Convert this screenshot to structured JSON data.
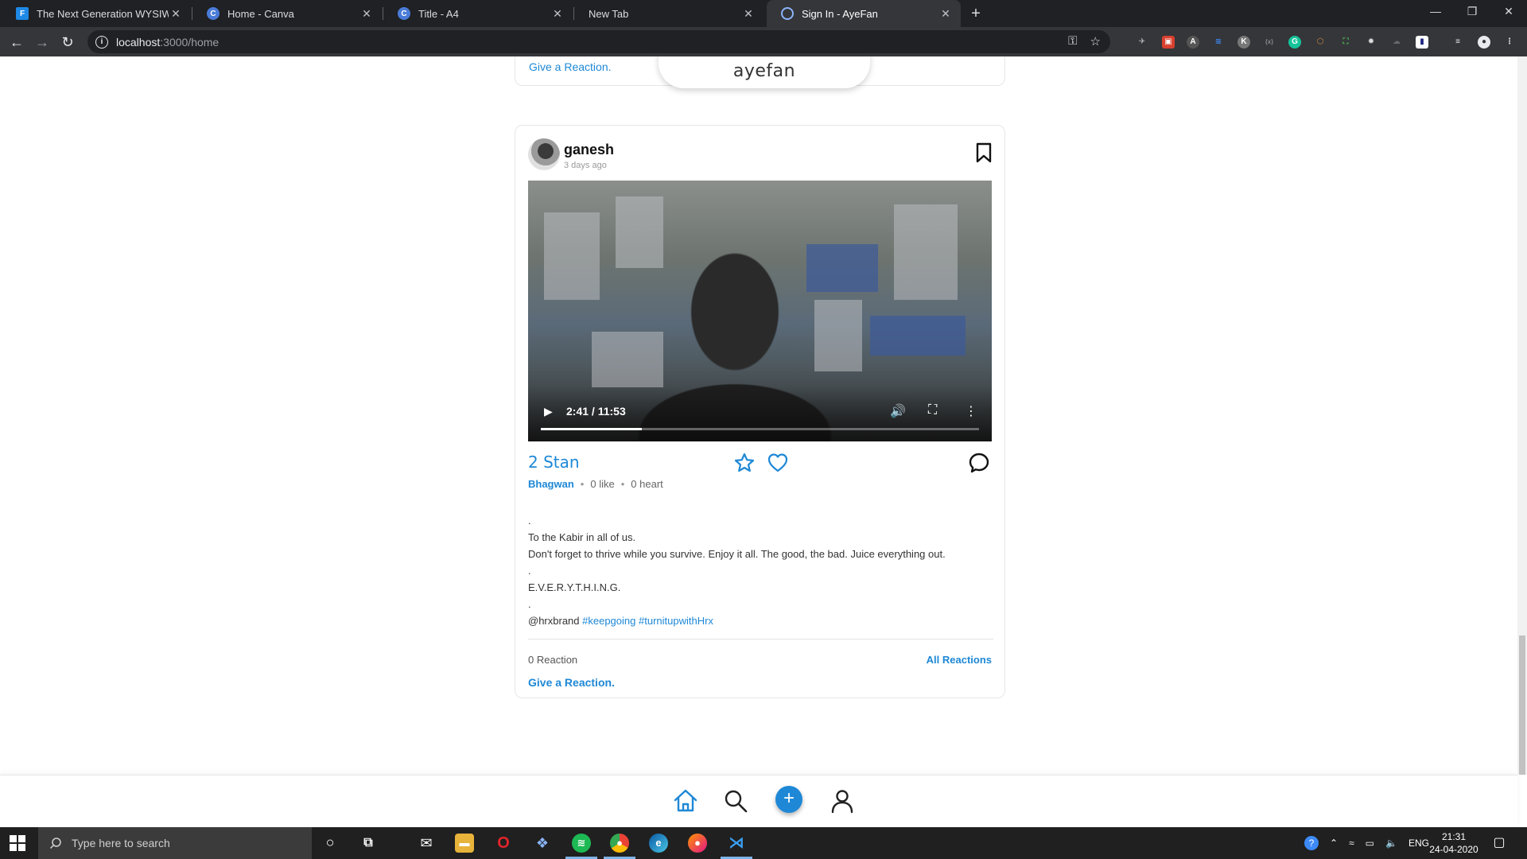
{
  "browser": {
    "tabs": [
      {
        "title": "The Next Generation WYSIWYG I",
        "favicon": "froala-icon",
        "fav_letter": "F",
        "fav_color": "#1e88e5"
      },
      {
        "title": "Home - Canva",
        "favicon": "canva-icon",
        "fav_letter": "C",
        "fav_color": "#4a7bd8"
      },
      {
        "title": "Title - A4",
        "favicon": "canva-icon",
        "fav_letter": "C",
        "fav_color": "#4a7bd8"
      },
      {
        "title": "New Tab",
        "favicon": "",
        "fav_letter": "",
        "fav_color": ""
      },
      {
        "title": "Sign In - AyeFan",
        "favicon": "ayefan-icon",
        "fav_letter": "",
        "fav_color": "#1e88d6"
      }
    ],
    "url_host": "localhost",
    "url_path": ":3000/home"
  },
  "app": {
    "brand": "ayefan",
    "previous_post": {
      "give_reaction": "Give a Reaction."
    },
    "post": {
      "username": "ganesh",
      "time": "3 days ago",
      "video": {
        "current_time": "2:41",
        "duration": "11:53",
        "progress": 0.23
      },
      "stan_count": "2 Stan",
      "tag": "Bhagwan",
      "likes": "0 like",
      "hearts": "0 heart",
      "caption_lines": [
        ".",
        "To the Kabir in all of us.",
        "Don't forget to thrive while you survive. Enjoy it all. The good, the bad. Juice everything out.",
        ".",
        "E.V.E.R.Y.T.H.I.N.G.",
        "."
      ],
      "caption_mention": "@hrxbrand",
      "hashtags": [
        "#keepgoing",
        "#turnitupwithHrx"
      ],
      "reaction_count": "0 Reaction",
      "all_reactions": "All Reactions",
      "give_reaction": "Give a Reaction."
    }
  },
  "taskbar": {
    "search_placeholder": "Type here to search",
    "language": "ENG",
    "time": "21:31",
    "date": "24-04-2020"
  }
}
